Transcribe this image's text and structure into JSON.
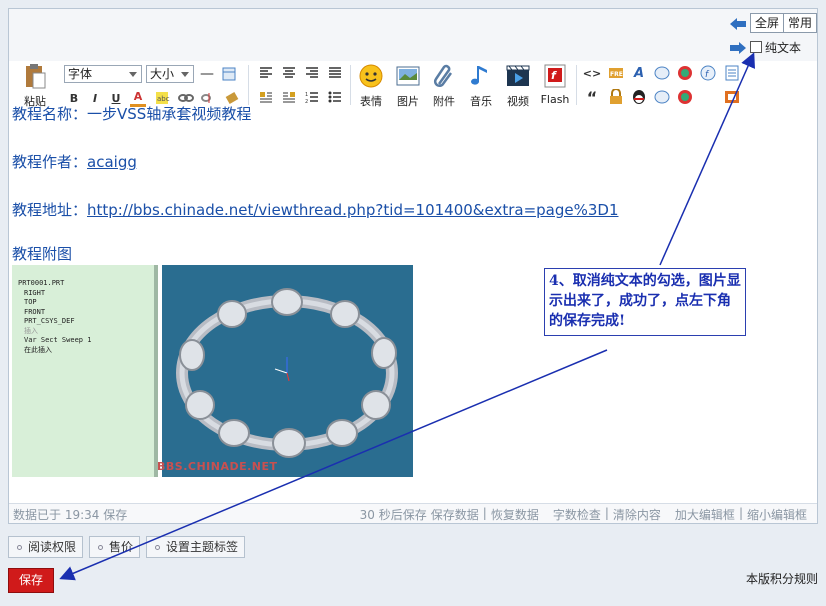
{
  "topbar": {
    "fullscreen_label": "全屏",
    "common_label": "常用",
    "plain_text_label": "纯文本",
    "undo_icon": "undo-arrow-icon",
    "redo_icon": "redo-arrow-icon"
  },
  "toolbar": {
    "paste_label": "粘贴",
    "font_select": "字体",
    "size_select": "大小",
    "bold": "B",
    "italic": "I",
    "underline": "U",
    "font_color": "A",
    "emotion_label": "表情",
    "image_label": "图片",
    "attach_label": "附件",
    "music_label": "音乐",
    "video_label": "视频",
    "flash_label": "Flash",
    "code_glyph": "<>",
    "quote_glyph": "“"
  },
  "content": {
    "name_label": "教程名称：",
    "name_value": "一步VSS轴承套视频教程",
    "author_label": "教程作者：",
    "author_value": "acaigg",
    "url_label": "教程地址：",
    "url_value": "http://bbs.chinade.net/viewthread.php?tid=101400&extra=page%3D1",
    "attach_label": "教程附图",
    "image": {
      "tree": [
        "PRT0001.PRT",
        "RIGHT",
        "TOP",
        "FRONT",
        "PRT_CSYS_DEF",
        "插入",
        "Var Sect Sweep 1",
        "在此插入"
      ],
      "watermark": "BBS.CHINADE.NET"
    }
  },
  "status": {
    "saved_text": "数据已于 19:34 保存",
    "autosave": "30 秒后保存",
    "save_data": "保存数据",
    "restore_data": "恢复数据",
    "word_check": "字数检查",
    "clear": "清除内容",
    "enlarge": "加大编辑框",
    "shrink": "缩小编辑框"
  },
  "bottom": {
    "read_perm": "阅读权限",
    "price": "售价",
    "topic_tags": "设置主题标签",
    "save": "保存",
    "rules": "本版积分规则"
  },
  "annotation": {
    "text": "4、取消纯文本的勾选，图片显示出来了，成功了，点左下角的保存完成!",
    "color": "#1a2fb0"
  }
}
